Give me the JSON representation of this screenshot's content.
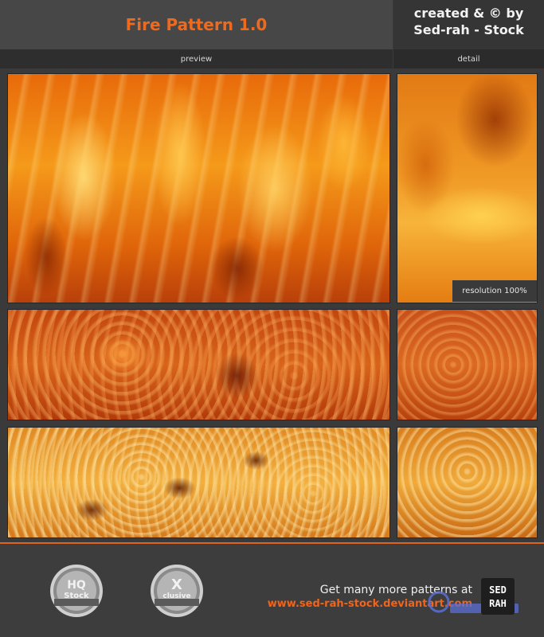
{
  "header": {
    "title": "Fire Pattern 1.0",
    "credit_line1": "created & © by",
    "credit_line2": "Sed-rah - Stock"
  },
  "labels": {
    "preview": "preview",
    "detail": "detail",
    "resolution": "resolution 100%"
  },
  "footer": {
    "promo_line": "Get many more patterns at",
    "promo_url": "www.sed-rah-stock.deviantart.com",
    "badge_hq": {
      "top": "HQ",
      "bottom": "Stock"
    },
    "badge_x": {
      "top": "X",
      "bottom": "clusive"
    },
    "logo_text": [
      "SED",
      "RAH"
    ]
  },
  "colors": {
    "accent": "#f06a1e",
    "header_bg": "#474747",
    "body_bg": "#3a3a3a"
  }
}
